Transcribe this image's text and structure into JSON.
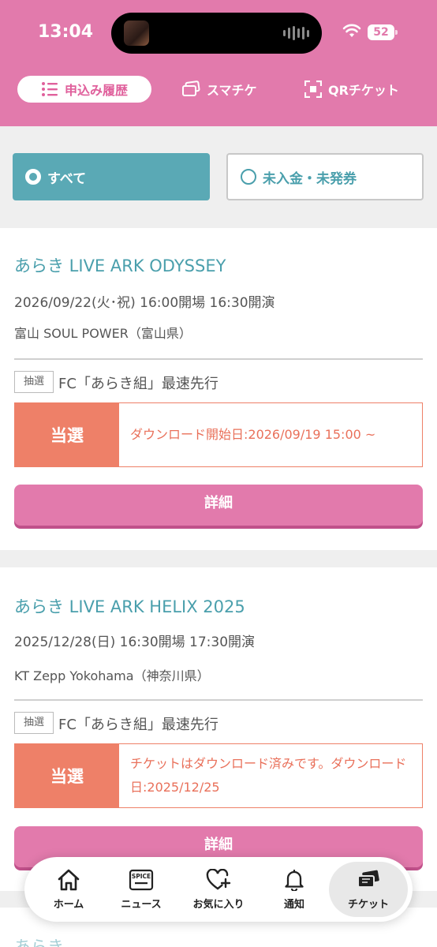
{
  "status": {
    "time": "13:04",
    "battery": "52"
  },
  "top_tabs": [
    {
      "label": "申込み履歴",
      "icon": "list-icon"
    },
    {
      "label": "スマチケ",
      "icon": "tickets-icon"
    },
    {
      "label": "QRチケット",
      "icon": "qr-scan-icon"
    }
  ],
  "filters": {
    "all_label": "すべて",
    "unpaid_label": "未入金・未発券"
  },
  "cards": [
    {
      "title": "あらき LIVE ARK ODYSSEY",
      "date": "2026/09/22(火･祝) 16:00開場 16:30開演",
      "venue": "富山 SOUL POWER（富山県）",
      "lottery_tag": "抽選",
      "lottery_name": "FC「あらき組」最速先行",
      "result": "当選",
      "message": "ダウンロード開始日:2026/09/19 15:00 ~",
      "detail_label": "詳細"
    },
    {
      "title": "あらき LIVE ARK HELIX 2025",
      "date": "2025/12/28(日) 16:30開場 17:30開演",
      "venue": "KT Zepp Yokohama（神奈川県）",
      "lottery_tag": "抽選",
      "lottery_name": "FC「あらき組」最速先行",
      "result": "当選",
      "message": "チケットはダウンロード済みです。ダウンロード日:2025/12/25",
      "detail_label": "詳細"
    },
    {
      "title": "あらき"
    }
  ],
  "bottom_nav": [
    {
      "label": "ホーム",
      "icon": "home-icon"
    },
    {
      "label": "ニュース",
      "icon": "spice-news-icon",
      "icon_text": "SPICE"
    },
    {
      "label": "お気に入り",
      "icon": "heart-plus-icon"
    },
    {
      "label": "通知",
      "icon": "bell-icon"
    },
    {
      "label": "チケット",
      "icon": "ticket-icon"
    }
  ],
  "colors": {
    "header": "#e27aac",
    "teal": "#5aa9b5",
    "win": "#ee8068"
  }
}
